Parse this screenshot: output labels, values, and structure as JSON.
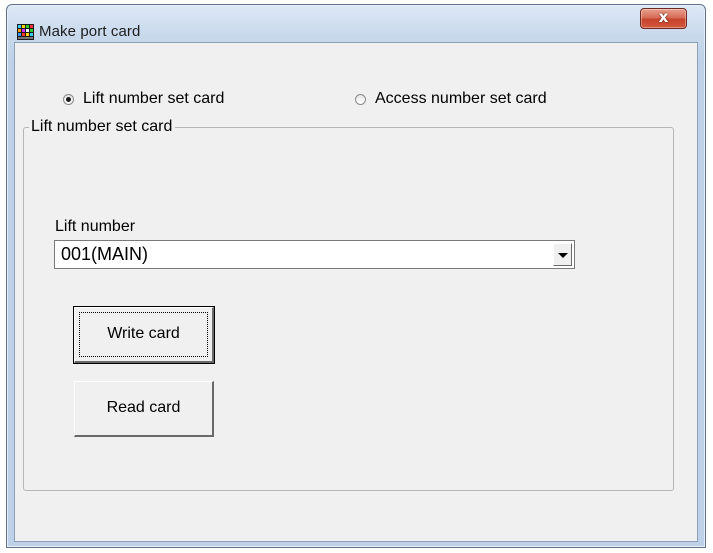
{
  "window": {
    "title": "Make port card",
    "icon": "app-icon",
    "close_symbol": "x"
  },
  "card_type": {
    "options": [
      {
        "label": "Lift number set card",
        "checked": true
      },
      {
        "label": "Access number set card",
        "checked": false
      }
    ]
  },
  "group": {
    "legend": "Lift number set card",
    "lift_number_label": "Lift number",
    "lift_number_value": "001(MAIN)",
    "write_button": "Write card",
    "read_button": "Read card"
  }
}
